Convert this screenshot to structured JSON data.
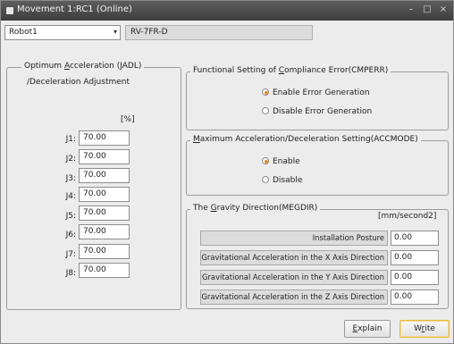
{
  "window": {
    "title": "Movement 1:RC1 (Online)",
    "minimize_glyph": "–",
    "restore_glyph": "□",
    "close_glyph": "×"
  },
  "robot": {
    "selected": "Robot1",
    "dropdown_arrow": "▾",
    "model": "RV-7FR-D"
  },
  "optimum": {
    "legend_prefix": "Optimum ",
    "legend_accel": "A",
    "legend_rest": "cceleration (JADL)",
    "sub_label": "/Deceleration Adjustment",
    "unit": "[%]",
    "joints": [
      {
        "label": "J1:",
        "value": "70.00"
      },
      {
        "label": "J2:",
        "value": "70.00"
      },
      {
        "label": "J3:",
        "value": "70.00"
      },
      {
        "label": "J4:",
        "value": "70.00"
      },
      {
        "label": "J5:",
        "value": "70.00"
      },
      {
        "label": "J6:",
        "value": "70.00"
      },
      {
        "label": "J7:",
        "value": "70.00"
      },
      {
        "label": "J8:",
        "value": "70.00"
      }
    ]
  },
  "compliance": {
    "legend_prefix": "Functional Setting of ",
    "legend_accel": "C",
    "legend_rest": "ompliance Error(CMPERR)",
    "option_enable": "Enable Error Generation",
    "option_disable": "Disable Error Generation",
    "selected": "enable"
  },
  "accmode": {
    "legend_accel": "M",
    "legend_rest": "aximum Acceleration/Deceleration Setting(ACCMODE)",
    "option_enable": "Enable",
    "option_disable": "Disable",
    "selected": "enable"
  },
  "gravity": {
    "legend_prefix": "The ",
    "legend_accel": "G",
    "legend_rest": "ravity Direction(MEGDIR)",
    "unit": "[mm/second2]",
    "rows": [
      {
        "label": "Installation Posture",
        "value": "0.00"
      },
      {
        "label": "Gravitational Acceleration in the X Axis Direction",
        "value": "0.00"
      },
      {
        "label": "Gravitational Acceleration in the Y Axis Direction",
        "value": "0.00"
      },
      {
        "label": "Gravitational Acceleration in the Z Axis Direction",
        "value": "0.00"
      }
    ]
  },
  "buttons": {
    "explain_accel": "E",
    "explain_rest": "xplain",
    "write_prefix": "W",
    "write_accel": "r",
    "write_rest": "ite"
  },
  "colors": {
    "radio_selected": "#e58a1c",
    "titlebar": "#4a4a4a",
    "write_focus": "#e8b84a"
  }
}
